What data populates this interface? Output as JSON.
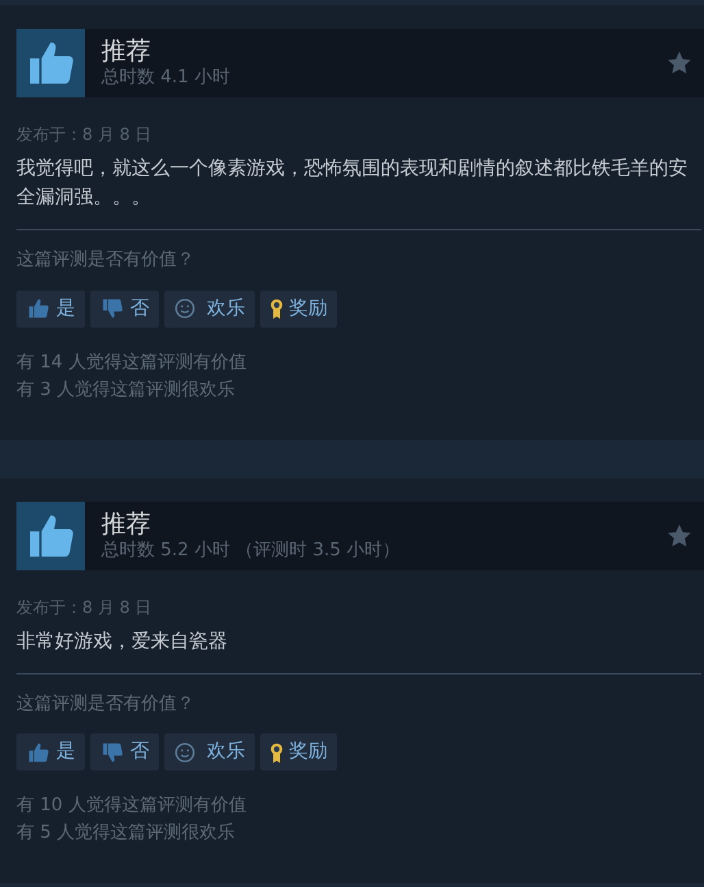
{
  "reviews": [
    {
      "verdict": "推荐",
      "recommended": true,
      "hours": "总时数 4.1 小时",
      "posted": "发布于：8 月 8 日",
      "body": "我觉得吧，就这么一个像素游戏，恐怖氛围的表现和剧情的叙述都比铁毛羊的安全漏洞强。。。",
      "question": "这篇评测是否有价值？",
      "buttons": [
        {
          "kind": "yes",
          "label": "是"
        },
        {
          "kind": "no",
          "label": "否"
        },
        {
          "kind": "funny",
          "label": "欢乐"
        },
        {
          "kind": "award",
          "label": "奖励"
        }
      ],
      "stats": [
        "有 14 人觉得这篇评测有价值",
        "有 3 人觉得这篇评测很欢乐"
      ]
    },
    {
      "verdict": "推荐",
      "recommended": true,
      "hours": "总时数 5.2 小时 （评测时 3.5 小时）",
      "posted": "发布于：8 月 8 日",
      "body": "非常好游戏，爱来自瓷器",
      "question": "这篇评测是否有价值？",
      "buttons": [
        {
          "kind": "yes",
          "label": "是"
        },
        {
          "kind": "no",
          "label": "否"
        },
        {
          "kind": "funny",
          "label": "欢乐"
        },
        {
          "kind": "award",
          "label": "奖励"
        }
      ],
      "stats": [
        "有 10 人觉得这篇评测有价值",
        "有 5 人觉得这篇评测很欢乐"
      ]
    }
  ]
}
